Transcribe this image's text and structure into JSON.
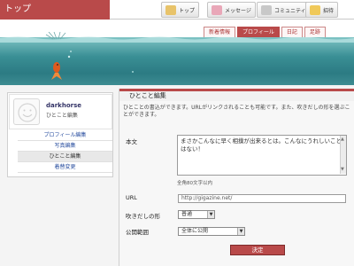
{
  "header": {
    "title": "トップ",
    "nav": [
      {
        "label": "トップ",
        "icon": "home-icon"
      },
      {
        "label": "メッセージ",
        "icon": "mail-icon"
      },
      {
        "label": "コミュニティ",
        "icon": "community-icon"
      },
      {
        "label": "招待",
        "icon": "invite-icon"
      }
    ],
    "tabs": [
      "新着情報",
      "プロフィール",
      "日記",
      "足跡"
    ]
  },
  "profile": {
    "username": "darkhorse",
    "subtitle": "ひとこと編集",
    "menu": [
      "プロフィール編集",
      "写真編集",
      "ひとこと編集",
      "着替変更"
    ]
  },
  "form": {
    "heading": "ひとこと編集",
    "description": "ひとことの書込ができます。URLがリンクされることも可能です。また、吹きだしの形を選ぶことができます。",
    "body_label": "本文",
    "body_value": "まさかこんなに早く相撲が出来るとは。こんなにうれしいことはない！",
    "body_hint": "全角80文字以内",
    "url_label": "URL",
    "url_value": "http://gigazine.net/",
    "bubble_label": "吹きだしの形",
    "bubble_value": "普通",
    "scope_label": "公開範囲",
    "scope_value": "全体に公開",
    "submit_label": "決定"
  },
  "colors": {
    "accent": "#b94a4a",
    "water": "#3a8f95"
  }
}
